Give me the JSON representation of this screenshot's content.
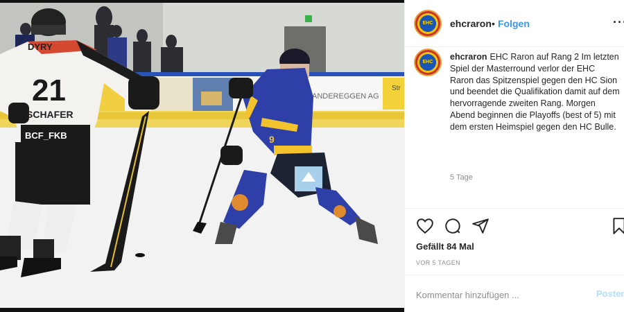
{
  "post": {
    "username": "ehcraron",
    "separator": "•",
    "follow_label": "Folgen",
    "more_label": "···"
  },
  "avatar": {
    "crest_text": "EHC"
  },
  "caption": {
    "username": "ehcraron",
    "text": "EHC Raron auf Rang 2 Im letzten Spiel der Masterround verlor der EHC Raron das Spitzenspiel gegen den HC Sion und beendet die Qualifikation damit auf dem hervorragende zweiten Rang. Morgen Abend beginnen die Playoffs (best of 5) mit dem ersten Heimspiel gegen den HC Bulle.",
    "time_ago": "5 Tage"
  },
  "actions": {
    "likes": "Gefällt 84 Mal",
    "date": "VOR 5 TAGEN"
  },
  "comment": {
    "placeholder": "Kommentar hinzufügen ...",
    "post_label": "Posten"
  },
  "photo": {
    "jersey_left_number": "21",
    "jersey_left_name": "SCHAFER",
    "jersey_left_sponsor": "BCF_FKB",
    "jersey_left_top": "DYRY",
    "jersey_right_number": "9",
    "board_text": "ANDEREGGEN AG",
    "board_text_2": "Str"
  },
  "colors": {
    "link_blue": "#3897f0",
    "post_disabled": "#b2dffc",
    "jersey_blue": "#2f3fa8",
    "jersey_yellow": "#f2c32c"
  }
}
